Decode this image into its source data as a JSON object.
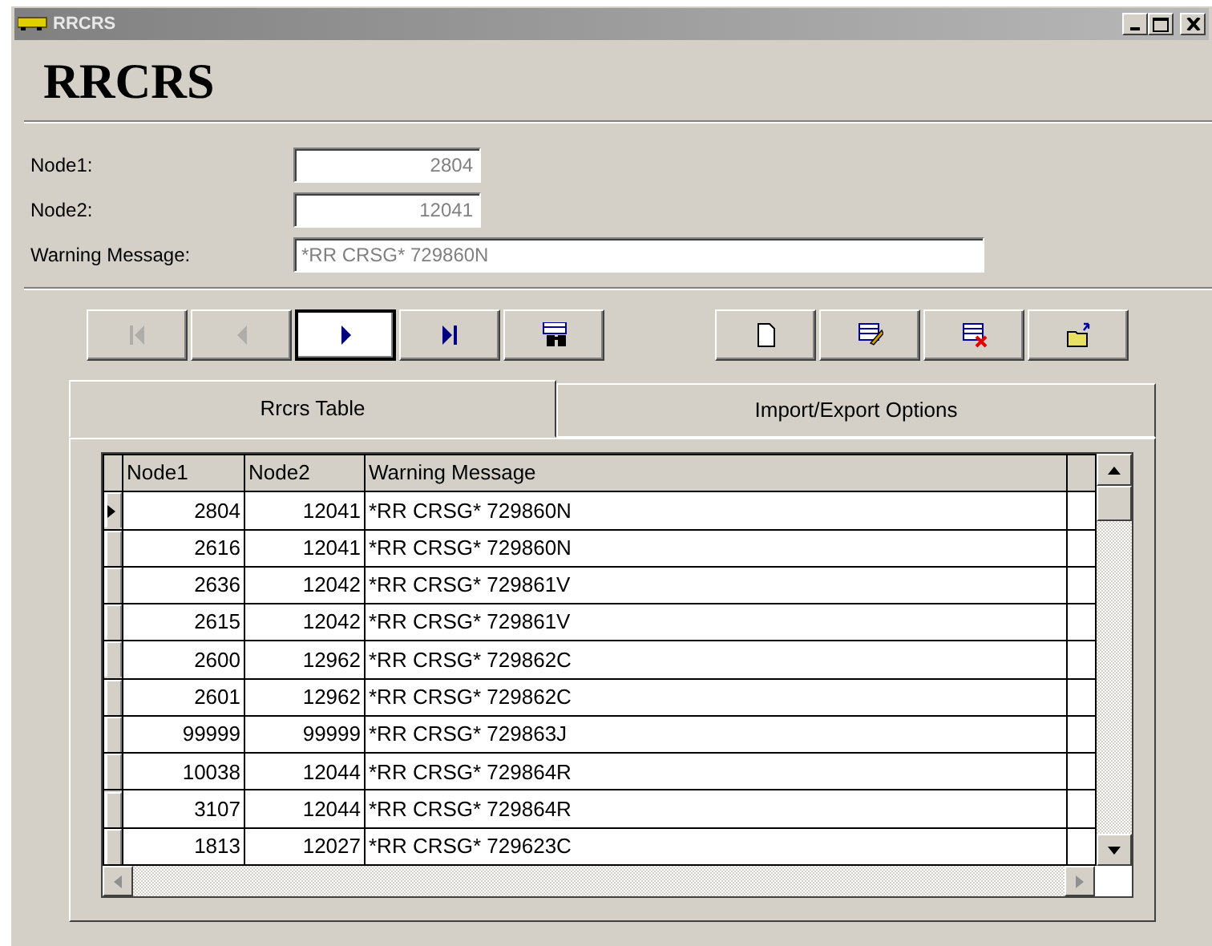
{
  "window": {
    "title": "RRCRS"
  },
  "heading": "RRCRS",
  "fields": [
    {
      "label": "Node1:",
      "value": "2804",
      "kind": "number"
    },
    {
      "label": "Node2:",
      "value": "12041",
      "kind": "number"
    },
    {
      "label": "Warning Message:",
      "value": "*RR CRSG* 729860N",
      "kind": "text"
    }
  ],
  "toolbar": {
    "navigation": [
      {
        "kind": "first",
        "disabled": true,
        "focused": false
      },
      {
        "kind": "previous",
        "disabled": true,
        "focused": false
      },
      {
        "kind": "next",
        "disabled": false,
        "focused": true
      },
      {
        "kind": "last",
        "disabled": false,
        "focused": false
      },
      {
        "kind": "find",
        "disabled": false,
        "focused": false
      }
    ],
    "actions": [
      {
        "kind": "new"
      },
      {
        "kind": "edit"
      },
      {
        "kind": "delete"
      },
      {
        "kind": "export"
      }
    ]
  },
  "tabs": [
    {
      "label": "Rrcrs Table",
      "selected": true
    },
    {
      "label": "Import/Export Options",
      "selected": false
    }
  ],
  "table": {
    "columns": [
      "Node1",
      "Node2",
      "Warning Message"
    ],
    "rows": [
      {
        "node1": "2804",
        "node2": "12041",
        "message": "*RR CRSG* 729860N",
        "selected": true
      },
      {
        "node1": "2616",
        "node2": "12041",
        "message": "*RR CRSG* 729860N",
        "selected": false
      },
      {
        "node1": "2636",
        "node2": "12042",
        "message": "*RR CRSG* 729861V",
        "selected": false
      },
      {
        "node1": "2615",
        "node2": "12042",
        "message": "*RR CRSG* 729861V",
        "selected": false
      },
      {
        "node1": "2600",
        "node2": "12962",
        "message": "*RR CRSG* 729862C",
        "selected": false
      },
      {
        "node1": "2601",
        "node2": "12962",
        "message": "*RR CRSG* 729862C",
        "selected": false
      },
      {
        "node1": "99999",
        "node2": "99999",
        "message": "*RR CRSG* 729863J",
        "selected": false
      },
      {
        "node1": "10038",
        "node2": "12044",
        "message": "*RR CRSG* 729864R",
        "selected": false
      },
      {
        "node1": "3107",
        "node2": "12044",
        "message": "*RR CRSG* 729864R",
        "selected": false
      },
      {
        "node1": "1813",
        "node2": "12027",
        "message": "*RR CRSG* 729623C",
        "selected": false
      }
    ]
  }
}
